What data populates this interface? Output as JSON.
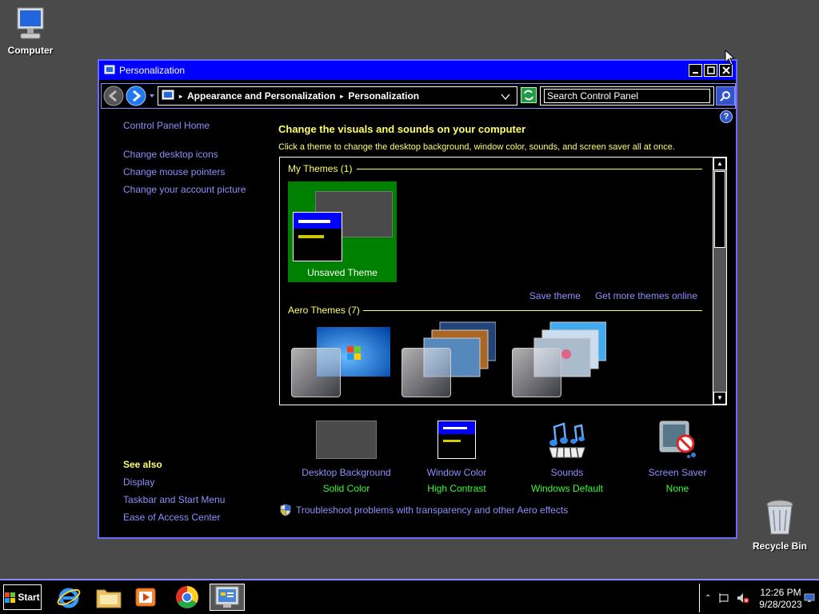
{
  "desktop": {
    "computer_label": "Computer",
    "recycle_label": "Recycle Bin"
  },
  "window": {
    "title": "Personalization",
    "breadcrumb": [
      "Appearance and Personalization",
      "Personalization"
    ],
    "search_placeholder": "Search Control Panel"
  },
  "left_pane": {
    "home": "Control Panel Home",
    "links": [
      "Change desktop icons",
      "Change mouse pointers",
      "Change your account picture"
    ]
  },
  "see_also": {
    "heading": "See also",
    "links": [
      "Display",
      "Taskbar and Start Menu",
      "Ease of Access Center"
    ]
  },
  "main": {
    "heading": "Change the visuals and sounds on your computer",
    "subheading": "Click a theme to change the desktop background, window color, sounds, and screen saver all at once.",
    "my_themes": "My Themes (1)",
    "unsaved_theme": "Unsaved Theme",
    "save_theme": "Save theme",
    "get_more": "Get more themes online",
    "aero_themes": "Aero Themes (7)",
    "trouble": "Troubleshoot problems with transparency and other Aero effects"
  },
  "settings": [
    {
      "label": "Desktop Background",
      "value": "Solid Color"
    },
    {
      "label": "Window Color",
      "value": "High Contrast"
    },
    {
      "label": "Sounds",
      "value": "Windows Default"
    },
    {
      "label": "Screen Saver",
      "value": "None"
    }
  ],
  "taskbar": {
    "start_label": "Start",
    "time": "12:26 PM",
    "date": "9/28/2023"
  },
  "colors": {
    "title_bar": "#0000ff",
    "link": "#8f8fff",
    "heading": "#ffff66",
    "value": "#33ff33",
    "selected_theme": "#008000"
  }
}
